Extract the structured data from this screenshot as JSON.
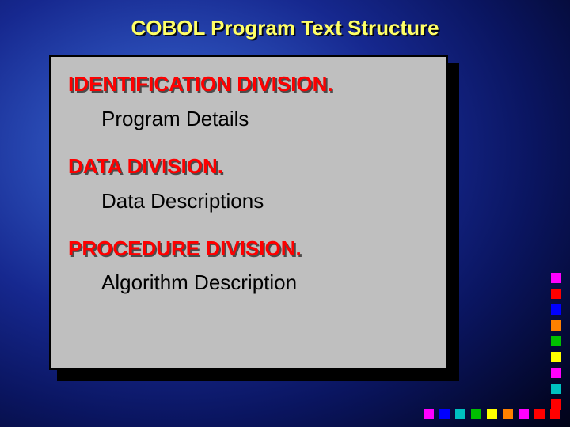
{
  "title": "COBOL Program Text Structure",
  "divisions": [
    {
      "heading": "IDENTIFICATION DIVISION.",
      "detail": "Program Details"
    },
    {
      "heading": "DATA DIVISION.",
      "detail": "Data Descriptions"
    },
    {
      "heading": "PROCEDURE DIVISION.",
      "detail": "Algorithm Description"
    }
  ],
  "squares_vertical_colors": [
    "#ff00ff",
    "#ff0000",
    "#0000ff",
    "#ff8000",
    "#00c000",
    "#ffff00",
    "#ff00ff",
    "#00c0c0",
    "#ff0000"
  ],
  "squares_horizontal_colors": [
    "#ff00ff",
    "#0000ff",
    "#00c0c0",
    "#00c000",
    "#ffff00",
    "#ff8000",
    "#ff00ff",
    "#ff0000",
    "#ff0000"
  ]
}
